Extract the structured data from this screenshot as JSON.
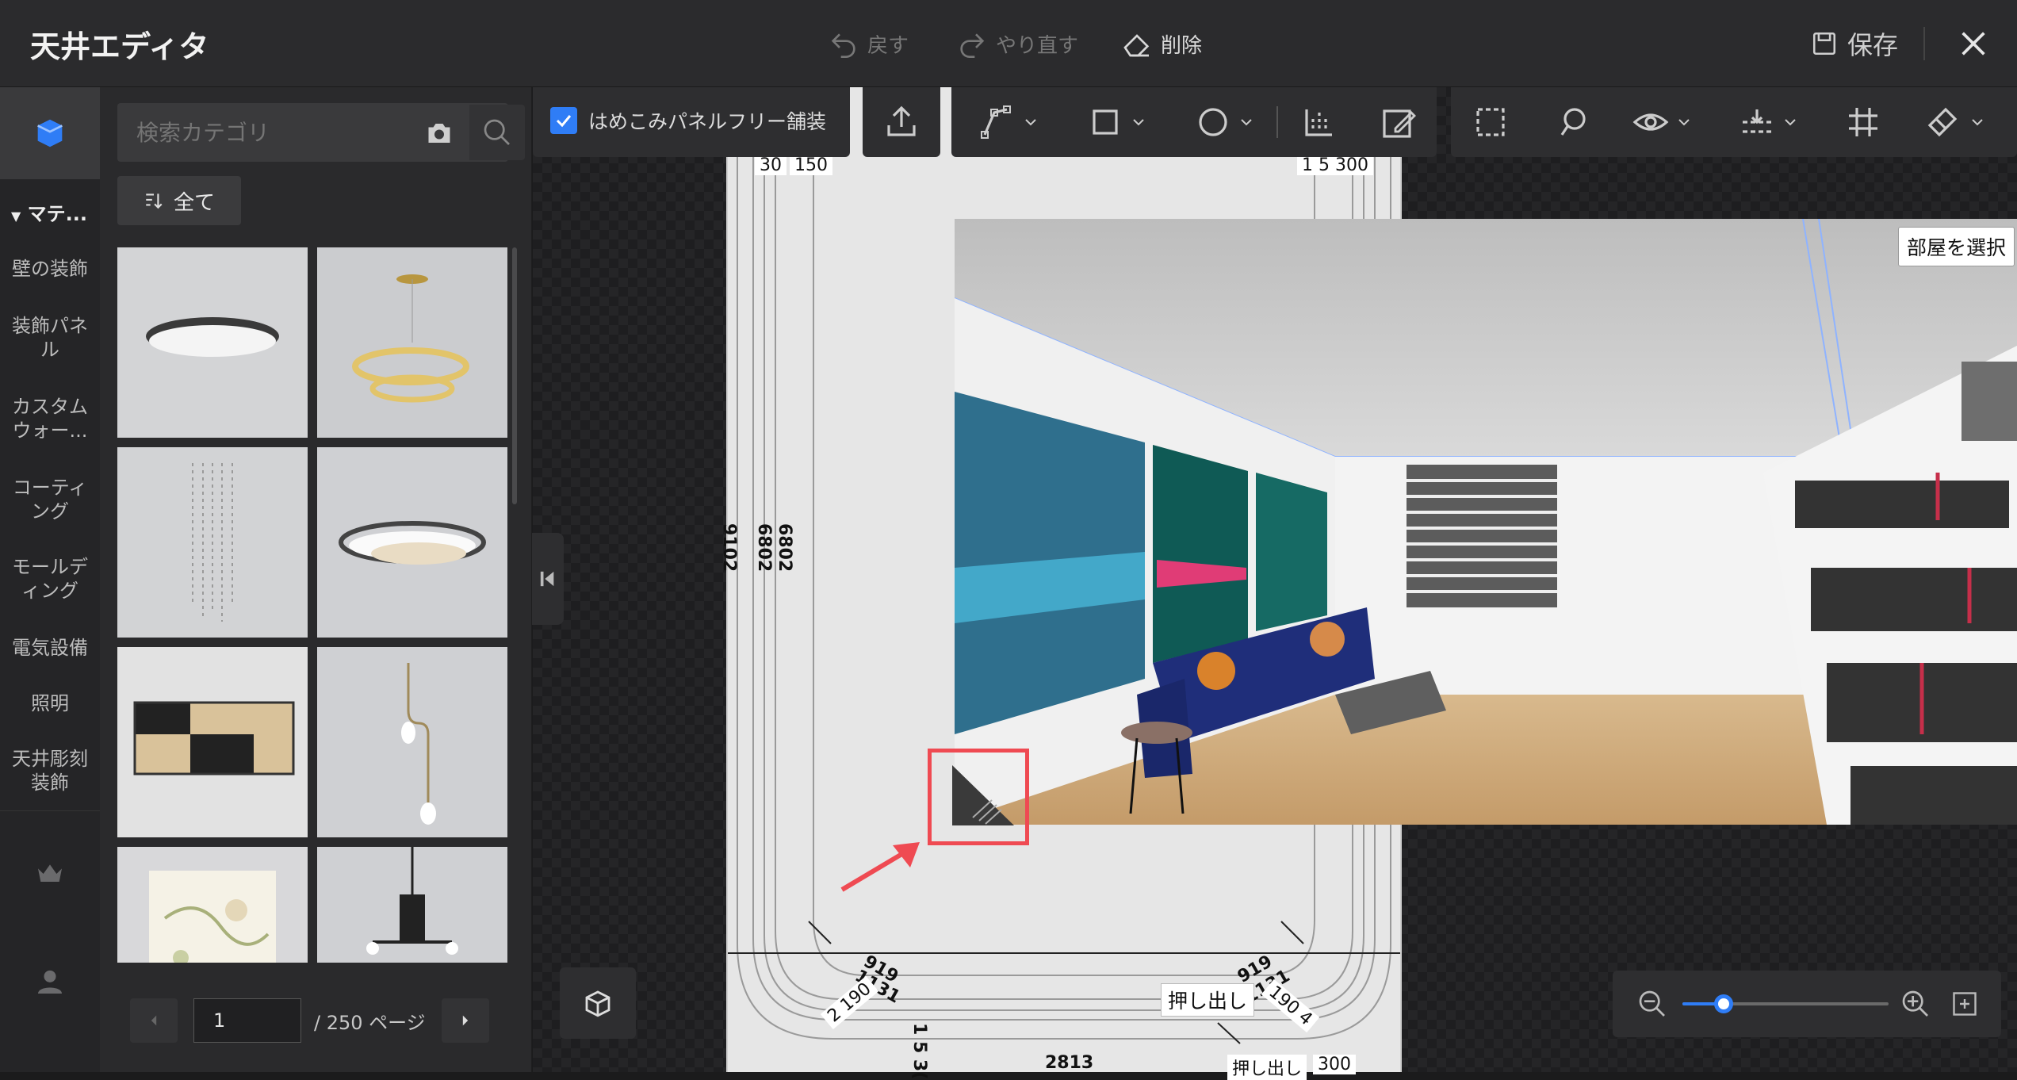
{
  "titlebar": {
    "app_title": "天井エディタ",
    "undo_label": "戻す",
    "redo_label": "やり直す",
    "delete_label": "削除",
    "save_label": "保存"
  },
  "leftnav": {
    "section_header": "マテ...",
    "items": [
      {
        "label": "壁の装飾"
      },
      {
        "label": "装飾パネル"
      },
      {
        "label": "カスタムウォー..."
      },
      {
        "label": "コーティング"
      },
      {
        "label": "モールディング"
      },
      {
        "label": "電気設備"
      },
      {
        "label": "照明"
      },
      {
        "label": "天井彫刻装飾"
      }
    ]
  },
  "panel": {
    "search_placeholder": "検索カテゴリ",
    "all_label": "全て",
    "products": [
      {
        "name": "ceiling-light-round-dark"
      },
      {
        "name": "pendant-ring-gold"
      },
      {
        "name": "crystal-chandelier"
      },
      {
        "name": "ceiling-light-ring-white"
      },
      {
        "name": "ceiling-light-square-wood"
      },
      {
        "name": "pendant-glass-drop"
      },
      {
        "name": "ceiling-light-floral-lantern"
      },
      {
        "name": "chandelier-black"
      }
    ],
    "pager": {
      "current_page": "1",
      "total_label": "/ 250 ページ"
    }
  },
  "toolbar": {
    "checkbox_label": "はめこみパネルフリー舗装",
    "checkbox_checked": true
  },
  "canvas": {
    "dim_top_left_1": "30",
    "dim_top_left_2": "150",
    "dim_top_right": "1 5 300",
    "dim_side_1": "9102",
    "dim_side_2": "6802",
    "dim_side_3": "6802",
    "dim_bottom_1": "919",
    "dim_bottom_2": "1131",
    "dim_bottom_3": "2 190",
    "dim_bottom_4": "919",
    "dim_bottom_5": "1131",
    "dim_bottom_6": "190 4",
    "dim_bottom_width": "2813",
    "dim_bottom_small": "1 5 3(",
    "dim_bottom_300": "300",
    "extrude_label": "押し出し",
    "extrude_label_2": "押し出し",
    "room_select_label": "部屋を選択"
  },
  "zoom": {
    "level": 0.2
  },
  "colors": {
    "accent": "#2f7df6",
    "highlight_marker": "#ef4a52",
    "background": "#1b1b1c"
  }
}
